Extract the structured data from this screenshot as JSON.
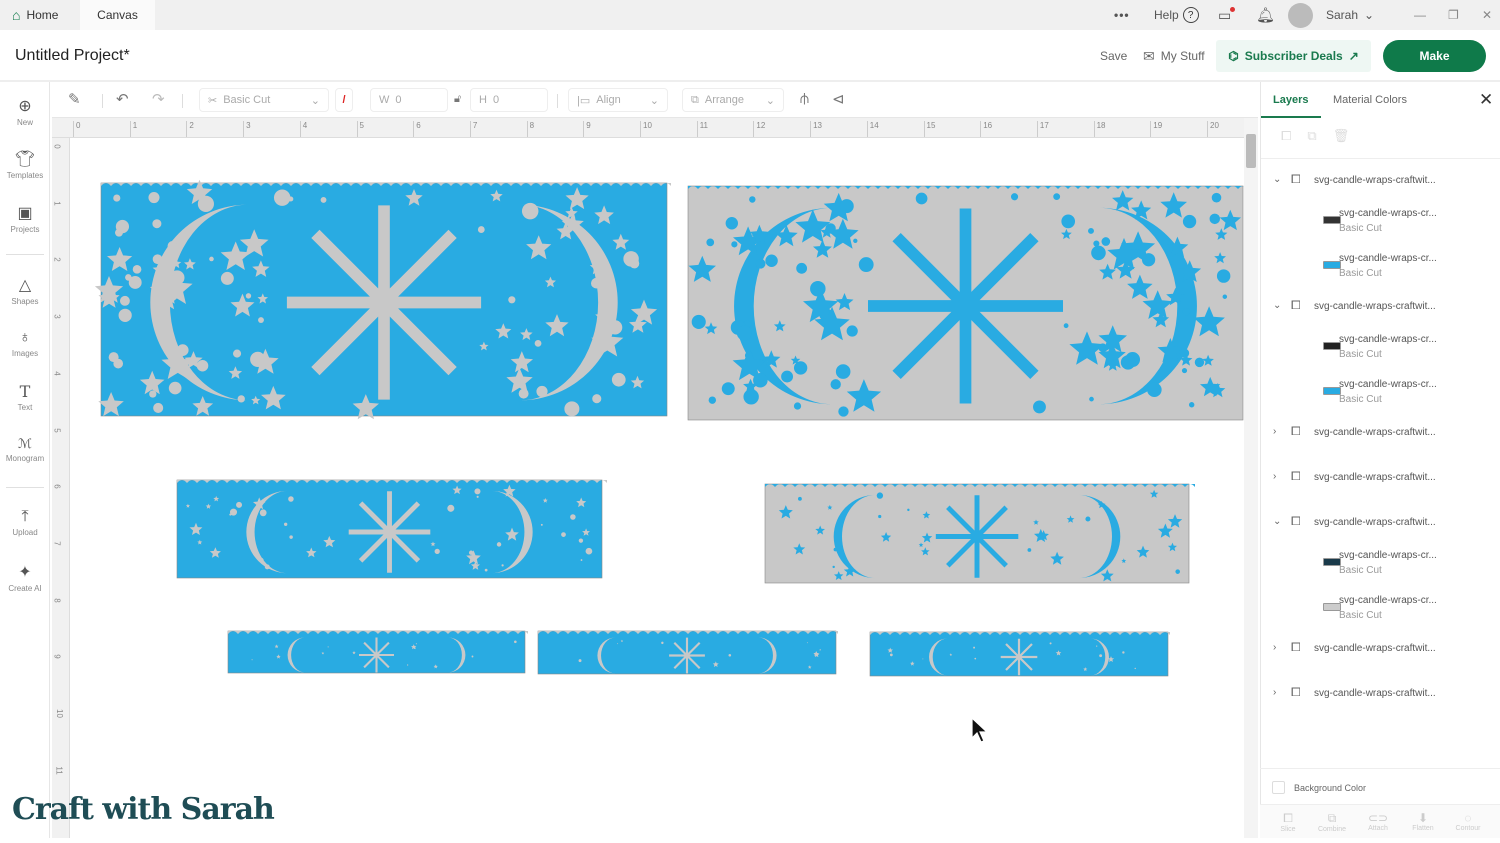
{
  "topbar": {
    "tabs": [
      "Home",
      "Canvas"
    ],
    "more": "•••",
    "help": "Help",
    "user": "Sarah"
  },
  "header": {
    "title": "Untitled Project*",
    "save": "Save",
    "my_stuff": "My Stuff",
    "deals": "Subscriber Deals",
    "make": "Make"
  },
  "toolbar": {
    "operation": "Basic Cut",
    "width_label": "W",
    "width": "0",
    "height_label": "H",
    "height": "0",
    "align": "Align",
    "arrange": "Arrange"
  },
  "sidebar": [
    "New",
    "Templates",
    "Projects",
    "Shapes",
    "Images",
    "Text",
    "Monogram",
    "Upload",
    "Create AI"
  ],
  "ruler": {
    "h": [
      "0",
      "1",
      "2",
      "3",
      "4",
      "5",
      "6",
      "7",
      "8",
      "9",
      "10",
      "11",
      "12",
      "13",
      "14",
      "15",
      "16",
      "17",
      "18",
      "19",
      "20"
    ],
    "v": [
      "0",
      "1",
      "2",
      "3",
      "4",
      "5",
      "6",
      "7",
      "8",
      "9",
      "10",
      "11"
    ]
  },
  "panel": {
    "tabs": [
      "Layers",
      "Material Colors"
    ],
    "layers": [
      {
        "name": "svg-candle-wraps-craftwit...",
        "expanded": true,
        "children": [
          {
            "name": "svg-candle-wraps-cr...",
            "op": "Basic Cut",
            "color": "#333333"
          },
          {
            "name": "svg-candle-wraps-cr...",
            "op": "Basic Cut",
            "color": "#29abe2"
          }
        ]
      },
      {
        "name": "svg-candle-wraps-craftwit...",
        "expanded": true,
        "children": [
          {
            "name": "svg-candle-wraps-cr...",
            "op": "Basic Cut",
            "color": "#222222"
          },
          {
            "name": "svg-candle-wraps-cr...",
            "op": "Basic Cut",
            "color": "#29abe2"
          }
        ]
      },
      {
        "name": "svg-candle-wraps-craftwit...",
        "expanded": false
      },
      {
        "name": "svg-candle-wraps-craftwit...",
        "expanded": false
      },
      {
        "name": "svg-candle-wraps-craftwit...",
        "expanded": true,
        "children": [
          {
            "name": "svg-candle-wraps-cr...",
            "op": "Basic Cut",
            "color": "#1a3a4a"
          },
          {
            "name": "svg-candle-wraps-cr...",
            "op": "Basic Cut",
            "color": "#cccccc"
          }
        ]
      },
      {
        "name": "svg-candle-wraps-craftwit...",
        "expanded": false
      },
      {
        "name": "svg-candle-wraps-craftwit...",
        "expanded": false
      }
    ],
    "background_color": "Background Color",
    "actions": [
      "Slice",
      "Combine",
      "Attach",
      "Flatten",
      "Contour"
    ]
  },
  "colors": {
    "blue": "#29abe2",
    "grey": "#c8c8c8",
    "green": "#0f7a4a"
  },
  "watermark": "Craft with Sarah"
}
